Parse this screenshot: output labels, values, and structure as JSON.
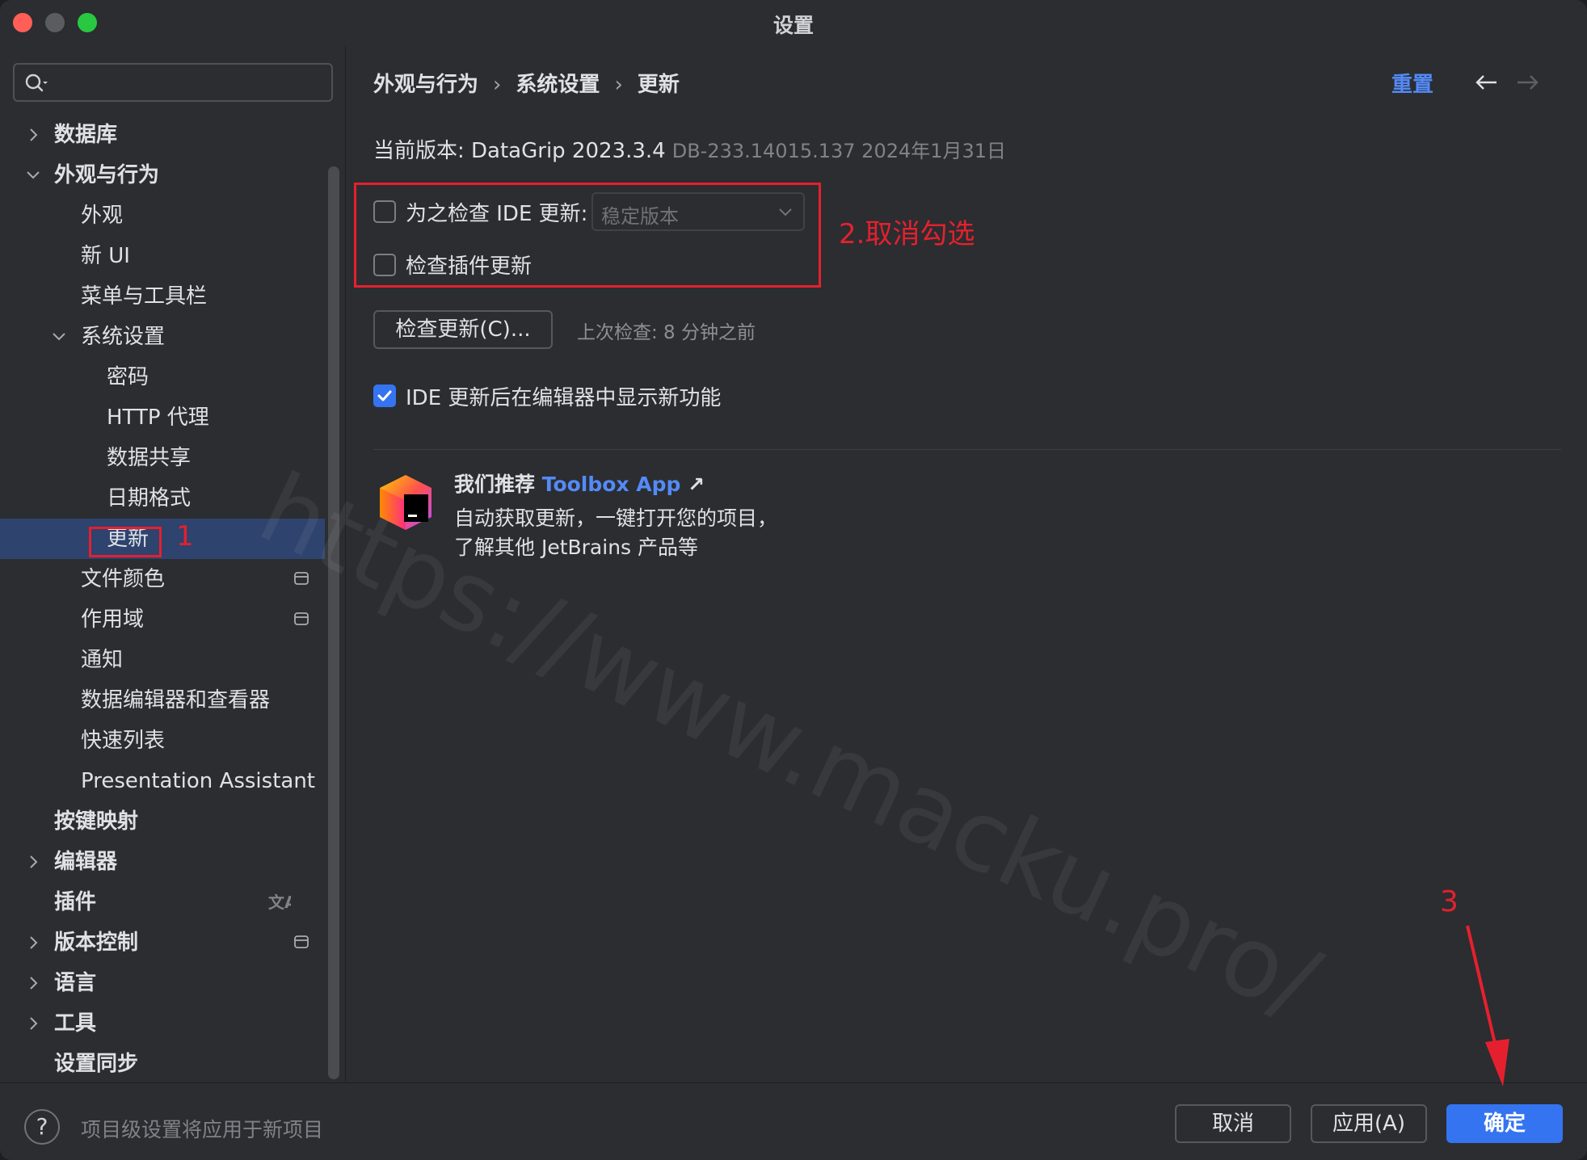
{
  "window": {
    "title": "设置"
  },
  "search": {
    "placeholder": ""
  },
  "sidebar": {
    "items": [
      {
        "label": "数据库",
        "level": 0,
        "bold": true,
        "arrow": "right"
      },
      {
        "label": "外观与行为",
        "level": 0,
        "bold": true,
        "arrow": "down"
      },
      {
        "label": "外观",
        "level": 1
      },
      {
        "label": "新 UI",
        "level": 1
      },
      {
        "label": "菜单与工具栏",
        "level": 1
      },
      {
        "label": "系统设置",
        "level": 1,
        "arrow": "down"
      },
      {
        "label": "密码",
        "level": 2
      },
      {
        "label": "HTTP 代理",
        "level": 2
      },
      {
        "label": "数据共享",
        "level": 2
      },
      {
        "label": "日期格式",
        "level": 2
      },
      {
        "label": "更新",
        "level": 2,
        "selected": true
      },
      {
        "label": "文件颜色",
        "level": 1,
        "icon": "project-scope-icon"
      },
      {
        "label": "作用域",
        "level": 1,
        "icon": "project-scope-icon"
      },
      {
        "label": "通知",
        "level": 1
      },
      {
        "label": "数据编辑器和查看器",
        "level": 1
      },
      {
        "label": "快速列表",
        "level": 1
      },
      {
        "label": "Presentation Assistant",
        "level": 1
      },
      {
        "label": "按键映射",
        "level": 0,
        "bold": true
      },
      {
        "label": "编辑器",
        "level": 0,
        "bold": true,
        "arrow": "right"
      },
      {
        "label": "插件",
        "level": 0,
        "bold": true,
        "icon": "translate-icon"
      },
      {
        "label": "版本控制",
        "level": 0,
        "bold": true,
        "arrow": "right",
        "icon": "project-scope-icon"
      },
      {
        "label": "语言",
        "level": 0,
        "bold": true,
        "arrow": "right"
      },
      {
        "label": "工具",
        "level": 0,
        "bold": true,
        "arrow": "right"
      },
      {
        "label": "设置同步",
        "level": 0,
        "bold": true
      }
    ]
  },
  "breadcrumb": {
    "part1": "外观与行为",
    "part2": "系统设置",
    "part3": "更新",
    "separator": "›"
  },
  "header": {
    "reset_label": "重置"
  },
  "version": {
    "label": "当前版本: DataGrip 2023.3.4",
    "build": "DB-233.14015.137 2024年1月31日"
  },
  "options": {
    "check_ide_label": "为之检查 IDE 更新:",
    "check_ide_checked": false,
    "channel_value": "稳定版本",
    "check_plugins_label": "检查插件更新",
    "check_plugins_checked": false,
    "check_now_label": "检查更新(C)...",
    "last_check": "上次检查: 8 分钟之前",
    "show_whats_new_label": "IDE 更新后在编辑器中显示新功能",
    "show_whats_new_checked": true
  },
  "toolbox": {
    "title_prefix": "我们推荐 ",
    "link": "Toolbox App",
    "link_suffix": " ↗",
    "desc_line1": "自动获取更新，一键打开您的项目，",
    "desc_line2": "了解其他 JetBrains 产品等"
  },
  "annotations": {
    "step1": "1",
    "step2": "2.取消勾选",
    "step3": "3"
  },
  "watermark": "https://www.macku.pro/",
  "footer": {
    "help": "?",
    "note": "项目级设置将应用于新项目",
    "cancel_label": "取消",
    "apply_label": "应用(A)",
    "ok_label": "确定"
  },
  "colors": {
    "accent": "#3574f0",
    "link": "#548af7",
    "annotation_red": "#e5202e",
    "selected_bg": "#2e436e"
  }
}
